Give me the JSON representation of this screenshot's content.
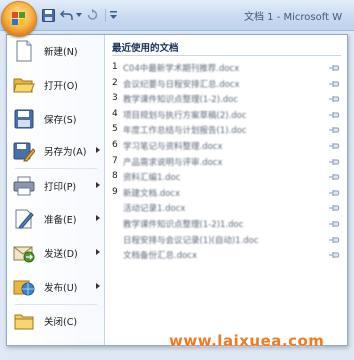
{
  "titlebar": {
    "window_title": "文档 1 - Microsoft W",
    "quick_access": [
      "save-icon",
      "undo-icon",
      "redo-icon",
      "customize-icon"
    ]
  },
  "commands": [
    {
      "label": "新建(N)",
      "icon": "new-document-icon",
      "submenu": false
    },
    {
      "label": "打开(O)",
      "icon": "open-folder-icon",
      "submenu": false
    },
    {
      "label": "保存(S)",
      "icon": "save-icon",
      "submenu": false
    },
    {
      "label": "另存为(A)",
      "icon": "save-as-icon",
      "submenu": true
    },
    {
      "label": "打印(P)",
      "icon": "print-icon",
      "submenu": true
    },
    {
      "label": "准备(E)",
      "icon": "prepare-icon",
      "submenu": true
    },
    {
      "label": "发送(D)",
      "icon": "send-icon",
      "submenu": true
    },
    {
      "label": "发布(U)",
      "icon": "publish-icon",
      "submenu": true
    },
    {
      "label": "关闭(C)",
      "icon": "close-folder-icon",
      "submenu": false
    }
  ],
  "recent": {
    "title": "最近使用的文档",
    "items": [
      {
        "num": "1",
        "name": "C04中最新学术期刊推荐.docx"
      },
      {
        "num": "2",
        "name": "会议纪要与日程安排汇总.docx"
      },
      {
        "num": "3",
        "name": "教学课件知识点整理(1-2).doc"
      },
      {
        "num": "4",
        "name": "项目规划与执行方案草稿(2).doc"
      },
      {
        "num": "5",
        "name": "年度工作总结与计划报告(1).doc"
      },
      {
        "num": "6",
        "name": "学习笔记与资料整理.docx"
      },
      {
        "num": "7",
        "name": "产品需求说明与评审.docx"
      },
      {
        "num": "8",
        "name": "资料汇编1.doc"
      },
      {
        "num": "9",
        "name": "新建文档.docx"
      },
      {
        "num": "",
        "name": "活动记录1.docx"
      },
      {
        "num": "",
        "name": "教学课件知识点整理(1-2)1.doc"
      },
      {
        "num": "",
        "name": "日程安排与会议记录(1)(自动)1.doc"
      },
      {
        "num": "",
        "name": "文档备份汇总.docx"
      }
    ]
  },
  "watermark": {
    "text": "www.laixuea.com"
  },
  "colors": {
    "accent": "#f47a20",
    "title_text": "#15325e",
    "border": "#8ba9d4"
  }
}
